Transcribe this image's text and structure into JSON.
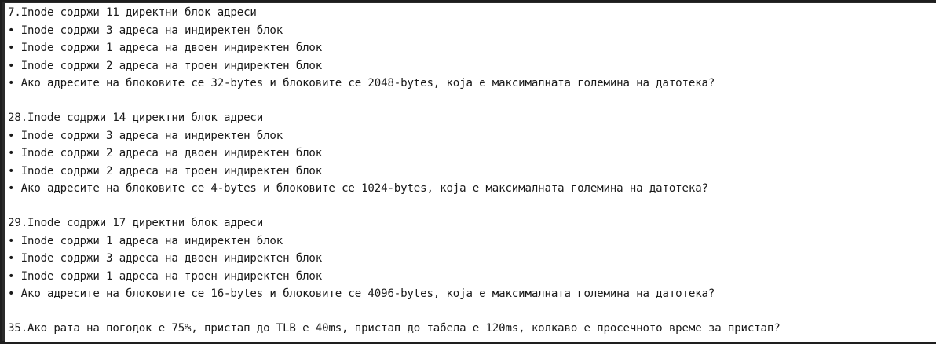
{
  "questions": [
    {
      "title": "7.Inode содржи 11 директни блок адреси",
      "bullets": [
        "• Inode содржи 3 адреса на индиректен блок",
        "• Inode содржи 1 адреса на двоен индиректен блок",
        "• Inode содржи 2 адреса на троен индиректен блок",
        "• Ако адресите на блоковите се 32-bytes и блоковите се 2048-bytes, која е максималната големина на датотека?"
      ]
    },
    {
      "title": "28.Inode содржи 14 директни блок адреси",
      "bullets": [
        "• Inode содржи 3 адреса на индиректен блок",
        "• Inode содржи 2 адреса на двоен индиректен блок",
        "• Inode содржи 2 адреса на троен индиректен блок",
        "• Ако адресите на блоковите се 4-bytes и блоковите се 1024-bytes, која е максималната големина на датотека?"
      ]
    },
    {
      "title": "29.Inode содржи 17 директни блок адреси",
      "bullets": [
        "• Inode содржи 1 адреса на индиректен блок",
        "• Inode содржи 3 адреса на двоен индиректен блок",
        "• Inode содржи 1 адреса на троен индиректен блок",
        "• Ако адресите на блоковите се 16-bytes и блоковите се 4096-bytes, која е максималната големина на датотека?"
      ]
    },
    {
      "title": "35.Ако рата на погодок е 75%, пристап до TLB е 40ms, пристап до табела е 120ms, колкаво е просечното време за пристап?",
      "bullets": []
    }
  ]
}
